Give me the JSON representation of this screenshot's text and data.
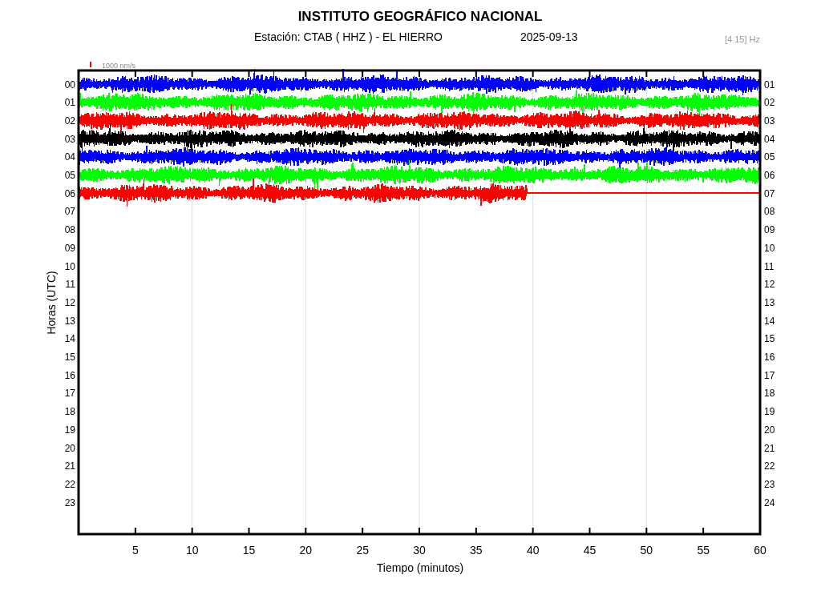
{
  "title": "INSTITUTO GEOGRÁFICO NACIONAL",
  "station_label": "Estación:  CTAB ( HHZ ) - EL HIERRO",
  "date": "2025-09-13",
  "filter": "[4 15] Hz",
  "scale_legend": "1000 nm/s",
  "ylabel": "Horas (UTC)",
  "xlabel": "Tiempo (minutos)",
  "left_hours": [
    "00",
    "01",
    "02",
    "03",
    "04",
    "05",
    "06",
    "07",
    "08",
    "09",
    "10",
    "11",
    "12",
    "13",
    "14",
    "15",
    "16",
    "17",
    "18",
    "19",
    "20",
    "21",
    "22",
    "23"
  ],
  "right_hours": [
    "01",
    "02",
    "03",
    "04",
    "05",
    "06",
    "07",
    "08",
    "09",
    "10",
    "11",
    "12",
    "13",
    "14",
    "15",
    "16",
    "17",
    "18",
    "19",
    "20",
    "21",
    "22",
    "23",
    "24"
  ],
  "xticks": [
    "5",
    "10",
    "15",
    "20",
    "25",
    "30",
    "35",
    "40",
    "45",
    "50",
    "55",
    "60"
  ],
  "traces": [
    {
      "kind": "full",
      "color": "#0000ff"
    },
    {
      "kind": "full",
      "color": "#00ff00"
    },
    {
      "kind": "full",
      "color": "#ff0000"
    },
    {
      "kind": "full",
      "color": "#000000"
    },
    {
      "kind": "full",
      "color": "#0000ff"
    },
    {
      "kind": "full",
      "color": "#00ff00"
    },
    {
      "kind": "partial",
      "color": "#ff0000"
    }
  ]
}
